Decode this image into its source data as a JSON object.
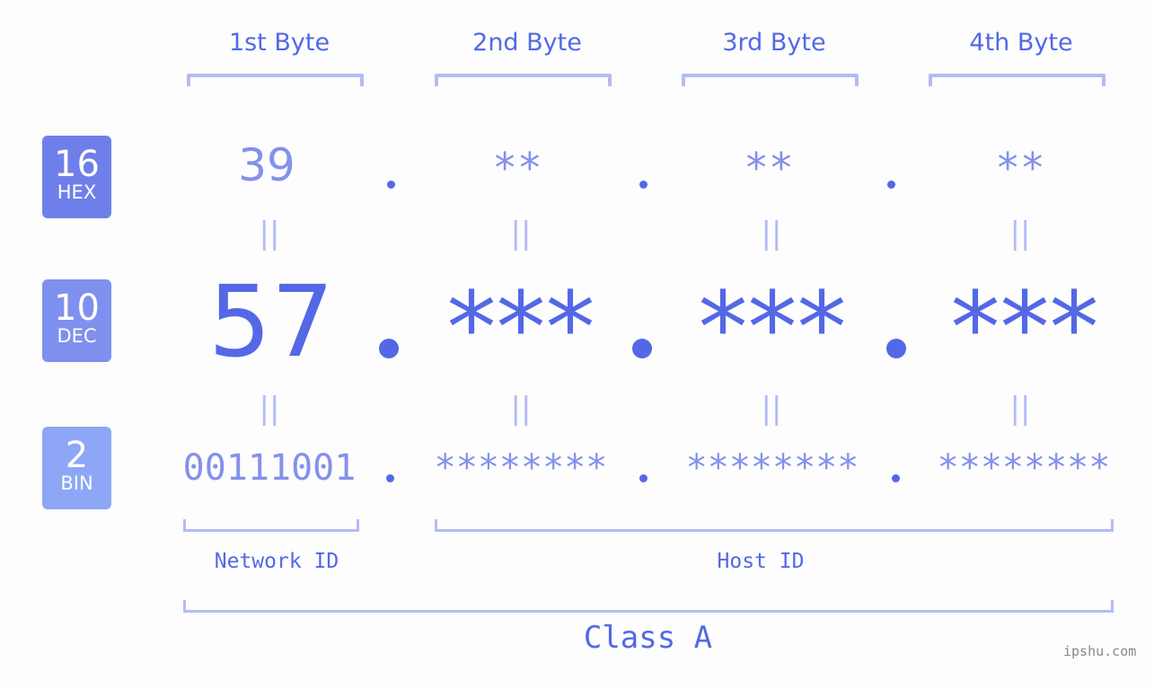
{
  "bytes": {
    "titles": [
      "1st Byte",
      "2nd Byte",
      "3rd Byte",
      "4th Byte"
    ]
  },
  "bases": [
    {
      "number": "16",
      "label": "HEX",
      "color": "#6f7fea"
    },
    {
      "number": "10",
      "label": "DEC",
      "color": "#8090ee"
    },
    {
      "number": "2",
      "label": "BIN",
      "color": "#8da6f5"
    }
  ],
  "hex": [
    "39",
    "**",
    "**",
    "**"
  ],
  "dec": [
    "57",
    "***",
    "***",
    "***"
  ],
  "bin": [
    "00111001",
    "********",
    "********",
    "********"
  ],
  "equals_glyph": "||",
  "labels": {
    "network_id": "Network ID",
    "host_id": "Host ID",
    "class": "Class A"
  },
  "watermark": "ipshu.com",
  "colors": {
    "primary": "#5468e6",
    "secondary": "#8490ec",
    "bracket": "#b3bbf6",
    "background": "#fcfdfc"
  }
}
